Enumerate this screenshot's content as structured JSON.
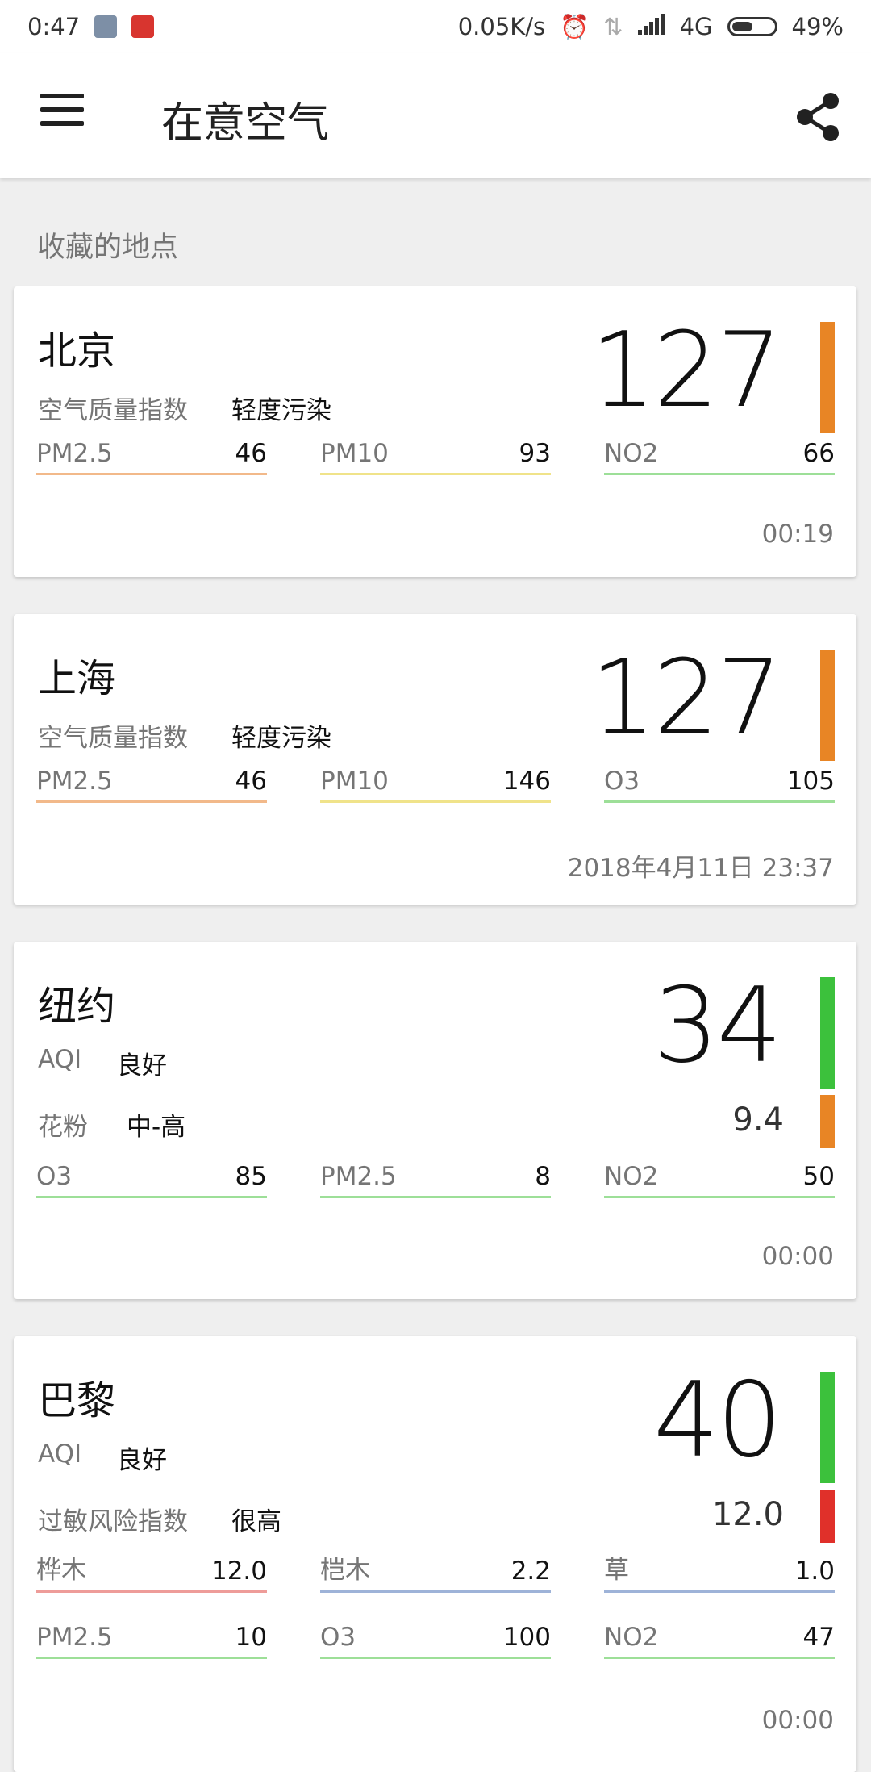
{
  "status": {
    "time": "0:47",
    "speed": "0.05K/s",
    "network": "4G",
    "battery": "49%",
    "battery_level": 0.49
  },
  "app": {
    "title": "在意空气"
  },
  "section_title": "收藏的地点",
  "colors": {
    "orange": "#e88525",
    "green": "#3cc13c",
    "red": "#e0302a",
    "line_orange": "#f2b98a",
    "line_yellow": "#f0e38a",
    "line_green": "#9ddf98",
    "line_red": "#ee9c99",
    "line_blue": "#9eb3d8"
  },
  "cards": [
    {
      "city": "北京",
      "label1": "空气质量指数",
      "value1": "轻度污染",
      "aqi": "127",
      "metrics": [
        {
          "name": "PM2.5",
          "value": "46"
        },
        {
          "name": "PM10",
          "value": "93"
        },
        {
          "name": "NO2",
          "value": "66"
        }
      ],
      "time": "00:19"
    },
    {
      "city": "上海",
      "label1": "空气质量指数",
      "value1": "轻度污染",
      "aqi": "127",
      "metrics": [
        {
          "name": "PM2.5",
          "value": "46"
        },
        {
          "name": "PM10",
          "value": "146"
        },
        {
          "name": "O3",
          "value": "105"
        }
      ],
      "time": "2018年4月11日 23:37"
    },
    {
      "city": "纽约",
      "label1": "AQI",
      "value1": "良好",
      "label2": "花粉",
      "value2": "中-高",
      "aqi": "34",
      "sub": "9.4",
      "metrics": [
        {
          "name": "O3",
          "value": "85"
        },
        {
          "name": "PM2.5",
          "value": "8"
        },
        {
          "name": "NO2",
          "value": "50"
        }
      ],
      "time": "00:00"
    },
    {
      "city": "巴黎",
      "label1": "AQI",
      "value1": "良好",
      "label2": "过敏风险指数",
      "value2": "很高",
      "aqi": "40",
      "sub": "12.0",
      "metrics": [
        {
          "name": "桦木",
          "value": "12.0"
        },
        {
          "name": "桤木",
          "value": "2.2"
        },
        {
          "name": "草",
          "value": "1.0"
        },
        {
          "name": "PM2.5",
          "value": "10"
        },
        {
          "name": "O3",
          "value": "100"
        },
        {
          "name": "NO2",
          "value": "47"
        }
      ],
      "time": "00:00"
    }
  ]
}
